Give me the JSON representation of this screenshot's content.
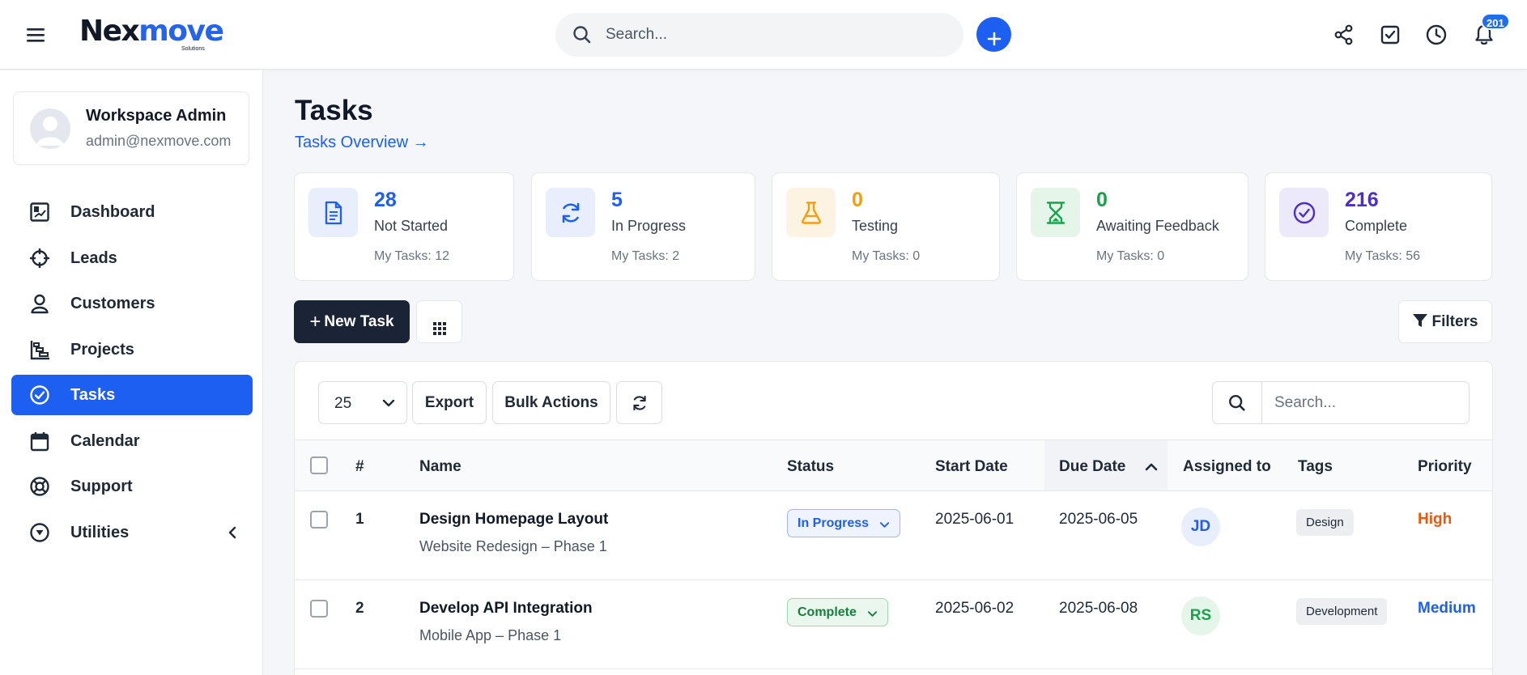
{
  "header": {
    "logo_main_left": "Ne",
    "logo_main_x": "x",
    "logo_main_right": "move",
    "logo_sub": "Solutions",
    "search_placeholder": "Search...",
    "notification_count": "201"
  },
  "profile": {
    "name": "Workspace Admin",
    "email": "admin@nexmove.com"
  },
  "sidebar": {
    "items": [
      {
        "label": "Dashboard",
        "icon": "dashboard-icon"
      },
      {
        "label": "Leads",
        "icon": "crosshair-icon"
      },
      {
        "label": "Customers",
        "icon": "user-icon"
      },
      {
        "label": "Projects",
        "icon": "gantt-icon"
      },
      {
        "label": "Tasks",
        "icon": "check-circle-icon",
        "active": true
      },
      {
        "label": "Calendar",
        "icon": "calendar-icon"
      },
      {
        "label": "Support",
        "icon": "lifebuoy-icon"
      },
      {
        "label": "Utilities",
        "icon": "chevron-circle-icon"
      }
    ]
  },
  "page": {
    "title": "Tasks",
    "overview_link": "Tasks Overview →"
  },
  "stats": [
    {
      "number": "28",
      "label": "Not Started",
      "my": "My Tasks: 12",
      "color": "#1d5ff0",
      "bg": "#e8eefc",
      "icon": "document-icon"
    },
    {
      "number": "5",
      "label": "In Progress",
      "my": "My Tasks: 2",
      "color": "#1d5ff0",
      "bg": "#e8eefc",
      "icon": "refresh-icon"
    },
    {
      "number": "0",
      "label": "Testing",
      "my": "My Tasks: 0",
      "color": "#f59e0b",
      "bg": "#fdf3e3",
      "icon": "flask-icon"
    },
    {
      "number": "0",
      "label": "Awaiting Feedback",
      "my": "My Tasks: 0",
      "color": "#16a34a",
      "bg": "#e6f5ea",
      "icon": "hourglass-icon"
    },
    {
      "number": "216",
      "label": "Complete",
      "my": "My Tasks: 56",
      "color": "#4c2fc9",
      "bg": "#ece9fb",
      "icon": "check-circle-icon"
    }
  ],
  "toolbar": {
    "new_task": "New Task",
    "filters": "Filters"
  },
  "table_toolbar": {
    "page_size": "25",
    "export": "Export",
    "bulk_actions": "Bulk Actions",
    "search_placeholder": "Search..."
  },
  "table": {
    "columns": [
      "#",
      "Name",
      "Status",
      "Start Date",
      "Due Date",
      "Assigned to",
      "Tags",
      "Priority"
    ],
    "rows": [
      {
        "num": "1",
        "name": "Design Homepage Layout",
        "project": "Website Redesign – Phase 1",
        "status": "In Progress",
        "start": "2025-06-01",
        "due": "2025-06-05",
        "assigned": "JD",
        "tag": "Design",
        "priority": "High"
      },
      {
        "num": "2",
        "name": "Develop API Integration",
        "project": "Mobile App – Phase 1",
        "status": "Complete",
        "start": "2025-06-02",
        "due": "2025-06-08",
        "assigned": "RS",
        "tag": "Development",
        "priority": "Medium"
      }
    ]
  },
  "colors": {
    "accent": "#1d5ff0",
    "dark_button": "#1b2437",
    "priority_high": "#ea580c",
    "priority_medium": "#1d5ff0"
  }
}
